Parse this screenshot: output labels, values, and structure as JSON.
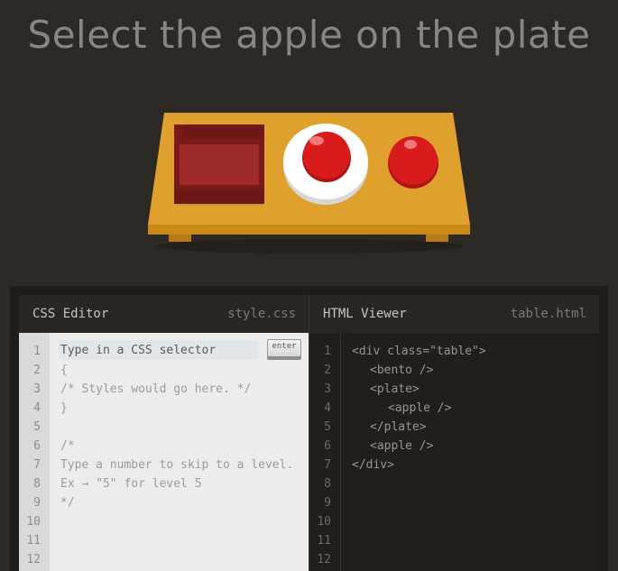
{
  "title": "Select the apple on the plate",
  "css_editor": {
    "name": "CSS Editor",
    "file": "style.css",
    "input_placeholder": "Type in a CSS selector",
    "enter_label": "enter",
    "line_numbers": [
      "1",
      "2",
      "3",
      "4",
      "5",
      "6",
      "7",
      "8",
      "9",
      "10",
      "11",
      "12"
    ],
    "lines": [
      "{",
      "/* Styles would go here. */",
      "}",
      "",
      "/*",
      "Type a number to skip to a level.",
      "Ex → \"5\" for level 5",
      "*/"
    ]
  },
  "html_viewer": {
    "name": "HTML Viewer",
    "file": "table.html",
    "line_numbers": [
      "1",
      "2",
      "3",
      "4",
      "5",
      "6",
      "7",
      "8",
      "9",
      "10",
      "11",
      "12"
    ],
    "lines": [
      "<div class=\"table\">",
      "<bento />",
      "<plate>",
      "<apple />",
      "</plate>",
      "<apple />",
      "</div>"
    ]
  },
  "colors": {
    "table": "#e0a02d",
    "bento": "#8c1f1f",
    "apple": "#d81c1c",
    "plate": "#ffffff"
  }
}
